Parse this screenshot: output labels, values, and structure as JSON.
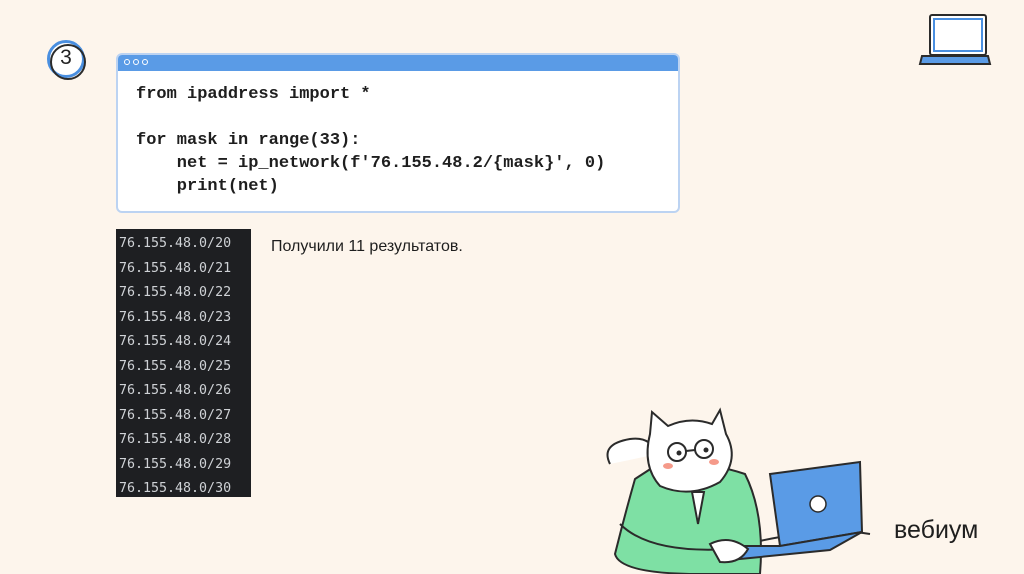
{
  "step": {
    "number": "3"
  },
  "code": {
    "lines": [
      "from ipaddress import *",
      "",
      "for mask in range(33):",
      "    net = ip_network(f'76.155.48.2/{mask}', 0)",
      "    print(net)"
    ]
  },
  "terminal": {
    "lines": [
      "76.155.48.0/20",
      "76.155.48.0/21",
      "76.155.48.0/22",
      "76.155.48.0/23",
      "76.155.48.0/24",
      "76.155.48.0/25",
      "76.155.48.0/26",
      "76.155.48.0/27",
      "76.155.48.0/28",
      "76.155.48.0/29",
      "76.155.48.0/30"
    ]
  },
  "result": {
    "text": "Получили 11 результатов."
  },
  "brand": {
    "name": "вебиум"
  },
  "colors": {
    "background": "#fdf5ec",
    "accent": "#5a9be6",
    "terminal": "#1e1f22",
    "sweater": "#7ee0a4"
  },
  "icons": {
    "top_right": "laptop-icon",
    "illustration": "cat-with-laptop-illustration"
  }
}
